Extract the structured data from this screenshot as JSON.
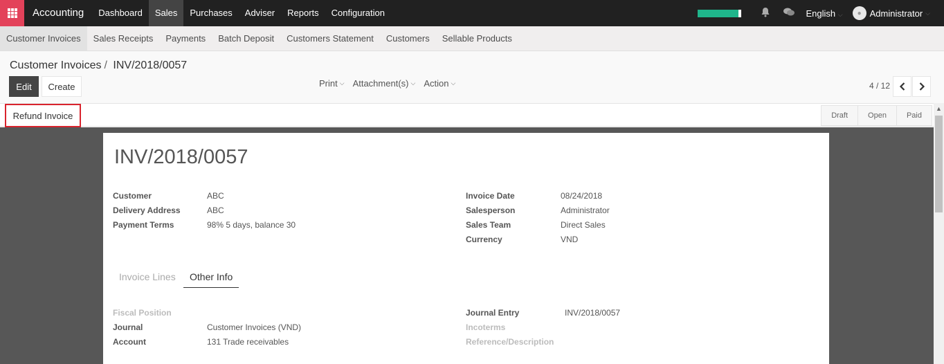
{
  "navbar": {
    "app_name": "Accounting",
    "menu": [
      "Dashboard",
      "Sales",
      "Purchases",
      "Adviser",
      "Reports",
      "Configuration"
    ],
    "active": "Sales",
    "language": "English",
    "user": "Administrator"
  },
  "submenu": {
    "items": [
      "Customer Invoices",
      "Sales Receipts",
      "Payments",
      "Batch Deposit",
      "Customers Statement",
      "Customers",
      "Sellable Products"
    ],
    "active": "Customer Invoices"
  },
  "control_panel": {
    "breadcrumb_parent": "Customer Invoices",
    "breadcrumb_sep": "/",
    "breadcrumb_current": "INV/2018/0057",
    "edit_label": "Edit",
    "create_label": "Create",
    "print_label": "Print",
    "attachments_label": "Attachment(s)",
    "action_label": "Action",
    "pager": "4 / 12"
  },
  "statusbar": {
    "refund_label": "Refund Invoice",
    "stages": [
      "Draft",
      "Open",
      "Paid"
    ]
  },
  "invoice": {
    "title": "INV/2018/0057",
    "left_fields": [
      {
        "label": "Customer",
        "value": "ABC"
      },
      {
        "label": "Delivery Address",
        "value": "ABC"
      },
      {
        "label": "Payment Terms",
        "value": "98% 5 days, balance 30"
      }
    ],
    "right_fields": [
      {
        "label": "Invoice Date",
        "value": "08/24/2018"
      },
      {
        "label": "Salesperson",
        "value": "Administrator"
      },
      {
        "label": "Sales Team",
        "value": "Direct Sales"
      },
      {
        "label": "Currency",
        "value": "VND"
      }
    ],
    "tabs": [
      "Invoice Lines",
      "Other Info"
    ],
    "active_tab": "Other Info",
    "other_left": [
      {
        "label": "Fiscal Position",
        "value": ""
      },
      {
        "label": "Journal",
        "value": "Customer Invoices (VND)"
      },
      {
        "label": "Account",
        "value": "131 Trade receivables"
      }
    ],
    "other_right": [
      {
        "label": "Journal Entry",
        "value": "INV/2018/0057"
      },
      {
        "label": "Incoterms",
        "value": ""
      },
      {
        "label": "Reference/Description",
        "value": ""
      }
    ]
  },
  "icons": {
    "apps": "grid-icon",
    "notifications": "bell-icon",
    "messages": "chat-icon"
  },
  "colors": {
    "navbar_bg": "#212121",
    "apps_bg": "#e3425a",
    "progress": "#1fb58b",
    "highlight_border": "#d9232d"
  }
}
